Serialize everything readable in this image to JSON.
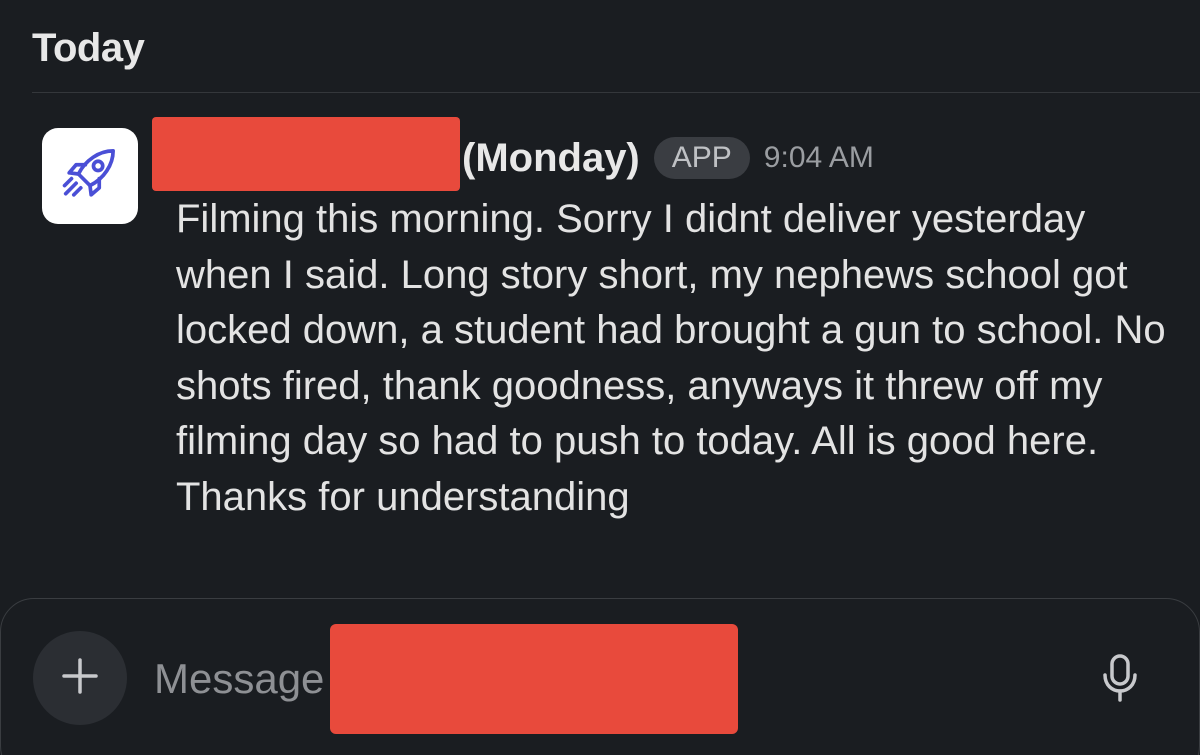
{
  "day_header": "Today",
  "message": {
    "sender_suffix": "(Monday)",
    "badge": "APP",
    "timestamp": "9:04 AM",
    "body": "Filming this morning. Sorry I didnt deliver yesterday when I said. Long story short, my nephews school got locked down, a student had brought a gun to school. No shots fired, thank goodness, anyways it threw off my filming day so had to push to today. All is good here. Thanks for understanding"
  },
  "composer": {
    "placeholder": "Message"
  },
  "icons": {
    "avatar": "rocket-icon",
    "add": "plus-icon",
    "mic": "microphone-icon"
  },
  "colors": {
    "background": "#1a1d21",
    "redaction": "#e84a3c",
    "avatar_icon": "#4a4fd6"
  }
}
